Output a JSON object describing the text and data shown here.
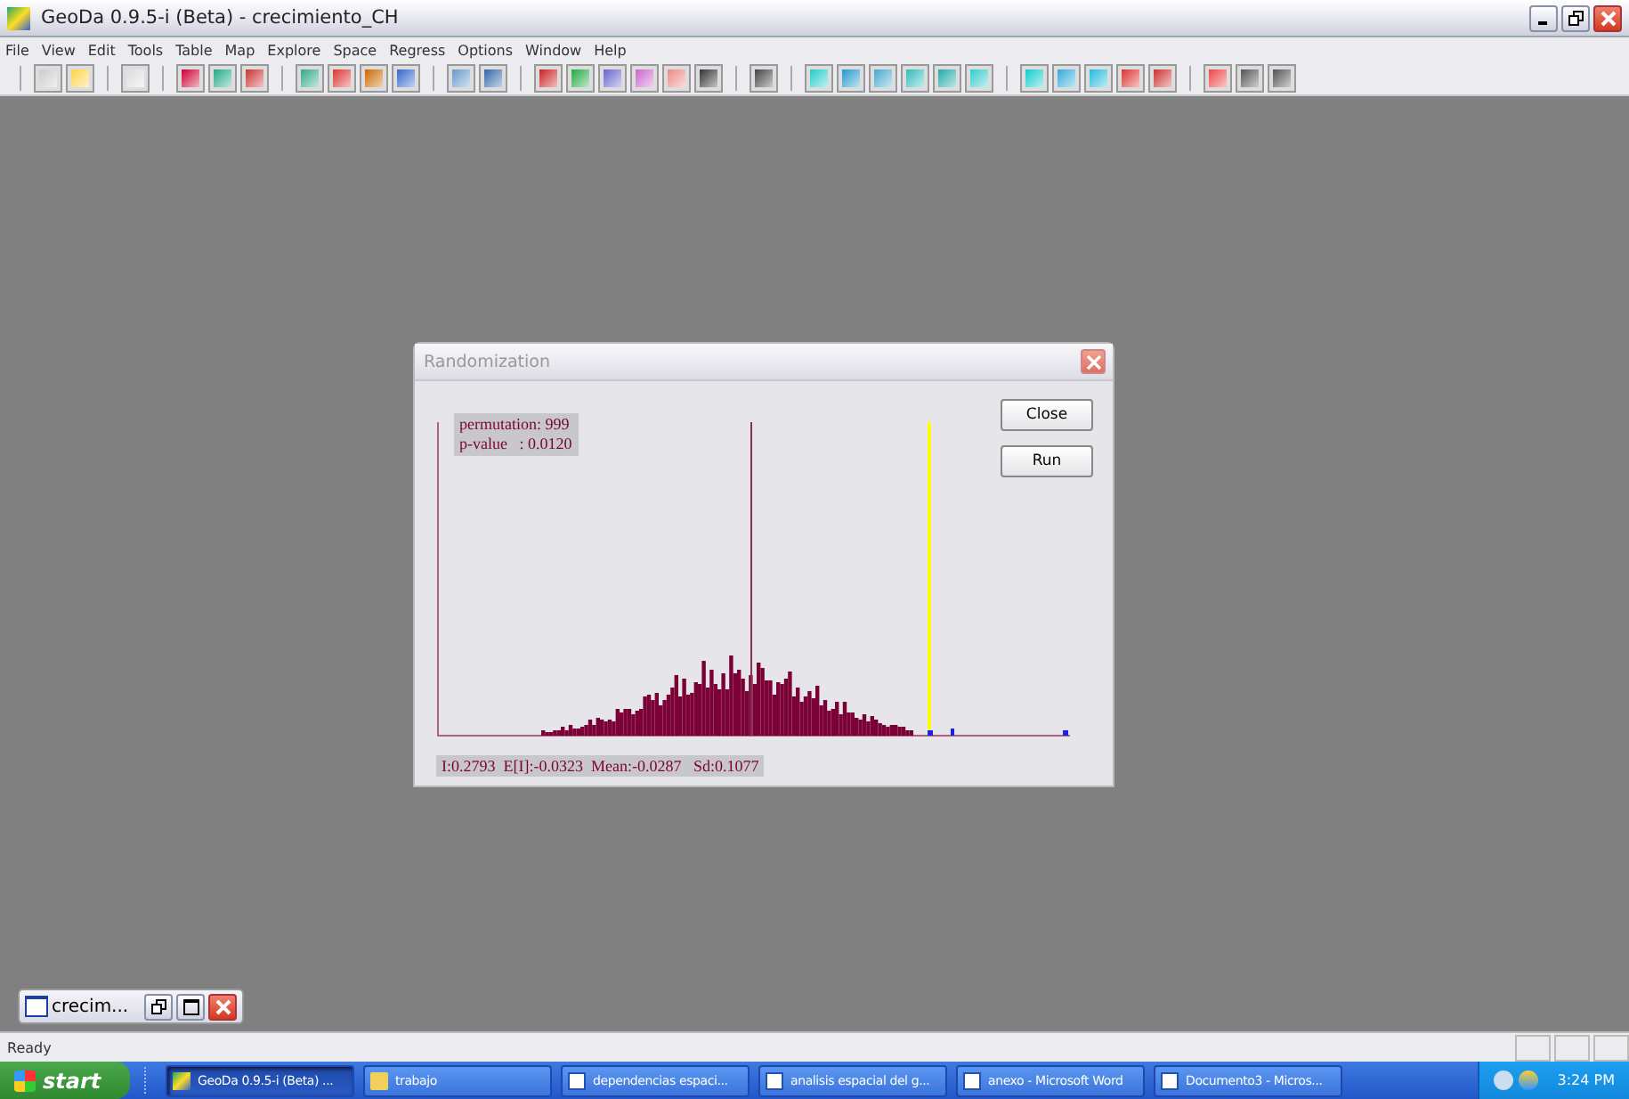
{
  "window": {
    "title": "GeoDa 0.9.5-i (Beta) - crecimiento_CH"
  },
  "menu": [
    "File",
    "View",
    "Edit",
    "Tools",
    "Table",
    "Map",
    "Explore",
    "Space",
    "Regress",
    "Options",
    "Window",
    "Help"
  ],
  "dialog": {
    "title": "Randomization",
    "stats": [
      "permutation: 999",
      "p-value   : 0.0120"
    ],
    "summary": "I:0.2793  E[I]:-0.0323  Mean:-0.0287   Sd:0.1077",
    "buttons": [
      "Close",
      "Run"
    ]
  },
  "minimized_window": {
    "title": "crecim..."
  },
  "status_bar": {
    "text": "Ready"
  },
  "taskbar": {
    "start": "start",
    "items": [
      {
        "label": "GeoDa 0.9.5-i (Beta) ...",
        "kind": "app",
        "selected": true
      },
      {
        "label": "trabajo",
        "kind": "folder",
        "selected": false
      },
      {
        "label": "dependencias espaci...",
        "kind": "word",
        "selected": false
      },
      {
        "label": "analisis espacial del g...",
        "kind": "word",
        "selected": false
      },
      {
        "label": "anexo - Microsoft Word",
        "kind": "word",
        "selected": false
      },
      {
        "label": "Documento3 - Micros...",
        "kind": "word",
        "selected": false
      }
    ],
    "clock": "3:24 PM"
  }
}
